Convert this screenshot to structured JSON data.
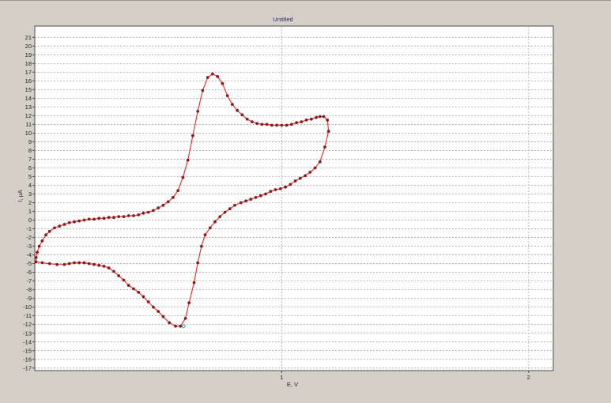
{
  "chart_data": {
    "type": "line",
    "title": "Untitled",
    "xlabel": "E, V",
    "ylabel": "I, µA",
    "xlim": [
      0.0,
      2.1
    ],
    "ylim": [
      -17.3,
      22.3
    ],
    "x_ticks": [
      1,
      2
    ],
    "y_ticks": [
      21,
      20,
      19,
      18,
      17,
      16,
      15,
      14,
      13,
      12,
      11,
      10,
      9,
      8,
      7,
      6,
      5,
      4,
      3,
      2,
      1,
      0,
      -1,
      -2,
      -3,
      -4,
      -5,
      -6,
      -7,
      -8,
      -9,
      -10,
      -11,
      -12,
      -13,
      -14,
      -15,
      -16,
      -17
    ],
    "grid": true,
    "colors": {
      "line": "#e03a3a",
      "marker": "#8a1c1c",
      "cursor_marker": "#2aa58a",
      "grid": "#a8a8a8",
      "background": "#ffffff",
      "window": "#d4d0c8",
      "title": "#1a1aa6"
    },
    "series": [
      {
        "points": [
          [
            0.59,
            -12.2
          ],
          [
            0.61,
            -11.3
          ],
          [
            0.625,
            -9.5
          ],
          [
            0.645,
            -7.2
          ],
          [
            0.66,
            -4.9
          ],
          [
            0.675,
            -3.0
          ],
          [
            0.69,
            -1.7
          ],
          [
            0.71,
            -0.9
          ],
          [
            0.73,
            -0.2
          ],
          [
            0.75,
            0.4
          ],
          [
            0.77,
            0.9
          ],
          [
            0.79,
            1.3
          ],
          [
            0.81,
            1.7
          ],
          [
            0.835,
            2.0
          ],
          [
            0.855,
            2.2
          ],
          [
            0.875,
            2.4
          ],
          [
            0.895,
            2.6
          ],
          [
            0.915,
            2.8
          ],
          [
            0.935,
            3.0
          ],
          [
            0.955,
            3.3
          ],
          [
            0.975,
            3.5
          ],
          [
            0.995,
            3.6
          ],
          [
            1.015,
            3.8
          ],
          [
            1.035,
            4.1
          ],
          [
            1.055,
            4.5
          ],
          [
            1.075,
            4.8
          ],
          [
            1.095,
            5.1
          ],
          [
            1.115,
            5.5
          ],
          [
            1.135,
            6.0
          ],
          [
            1.155,
            6.7
          ],
          [
            1.175,
            8.4
          ],
          [
            1.19,
            10.2
          ],
          [
            1.185,
            11.5
          ],
          [
            1.17,
            11.9
          ],
          [
            1.155,
            11.9
          ],
          [
            1.14,
            11.8
          ],
          [
            1.12,
            11.6
          ],
          [
            1.1,
            11.5
          ],
          [
            1.08,
            11.3
          ],
          [
            1.06,
            11.2
          ],
          [
            1.04,
            11.0
          ],
          [
            1.02,
            10.9
          ],
          [
            1.0,
            10.9
          ],
          [
            0.98,
            10.9
          ],
          [
            0.96,
            10.9
          ],
          [
            0.94,
            11.0
          ],
          [
            0.92,
            11.0
          ],
          [
            0.9,
            11.1
          ],
          [
            0.88,
            11.3
          ],
          [
            0.86,
            11.6
          ],
          [
            0.84,
            12.1
          ],
          [
            0.82,
            12.6
          ],
          [
            0.8,
            13.3
          ],
          [
            0.78,
            14.3
          ],
          [
            0.76,
            15.7
          ],
          [
            0.74,
            16.5
          ],
          [
            0.72,
            16.8
          ],
          [
            0.7,
            16.4
          ],
          [
            0.68,
            14.9
          ],
          [
            0.66,
            12.5
          ],
          [
            0.64,
            9.7
          ],
          [
            0.62,
            6.9
          ],
          [
            0.6,
            4.9
          ],
          [
            0.58,
            3.4
          ],
          [
            0.56,
            2.6
          ],
          [
            0.54,
            2.1
          ],
          [
            0.52,
            1.7
          ],
          [
            0.5,
            1.4
          ],
          [
            0.48,
            1.1
          ],
          [
            0.46,
            0.9
          ],
          [
            0.44,
            0.8
          ],
          [
            0.42,
            0.6
          ],
          [
            0.4,
            0.5
          ],
          [
            0.38,
            0.5
          ],
          [
            0.36,
            0.4
          ],
          [
            0.34,
            0.4
          ],
          [
            0.32,
            0.3
          ],
          [
            0.3,
            0.3
          ],
          [
            0.28,
            0.2
          ],
          [
            0.26,
            0.2
          ],
          [
            0.24,
            0.1
          ],
          [
            0.22,
            0.1
          ],
          [
            0.2,
            0.0
          ],
          [
            0.18,
            -0.1
          ],
          [
            0.16,
            -0.2
          ],
          [
            0.14,
            -0.3
          ],
          [
            0.12,
            -0.5
          ],
          [
            0.1,
            -0.7
          ],
          [
            0.08,
            -0.9
          ],
          [
            0.06,
            -1.3
          ],
          [
            0.045,
            -1.7
          ],
          [
            0.03,
            -2.4
          ],
          [
            0.018,
            -3.0
          ],
          [
            0.01,
            -3.7
          ],
          [
            0.005,
            -4.3
          ],
          [
            0.005,
            -4.8
          ],
          [
            0.03,
            -4.9
          ],
          [
            0.06,
            -5.0
          ],
          [
            0.09,
            -5.1
          ],
          [
            0.12,
            -5.1
          ],
          [
            0.14,
            -5.0
          ],
          [
            0.16,
            -4.9
          ],
          [
            0.18,
            -4.9
          ],
          [
            0.2,
            -4.9
          ],
          [
            0.22,
            -5.0
          ],
          [
            0.24,
            -5.1
          ],
          [
            0.26,
            -5.2
          ],
          [
            0.28,
            -5.3
          ],
          [
            0.3,
            -5.5
          ],
          [
            0.32,
            -5.9
          ],
          [
            0.34,
            -6.4
          ],
          [
            0.36,
            -6.9
          ],
          [
            0.38,
            -7.5
          ],
          [
            0.4,
            -7.9
          ],
          [
            0.42,
            -8.3
          ],
          [
            0.44,
            -8.8
          ],
          [
            0.46,
            -9.4
          ],
          [
            0.48,
            -10.0
          ],
          [
            0.5,
            -10.5
          ],
          [
            0.52,
            -11.1
          ],
          [
            0.545,
            -11.8
          ],
          [
            0.57,
            -12.2
          ]
        ]
      }
    ],
    "cursor_point": [
      0.59,
      -12.2
    ]
  }
}
